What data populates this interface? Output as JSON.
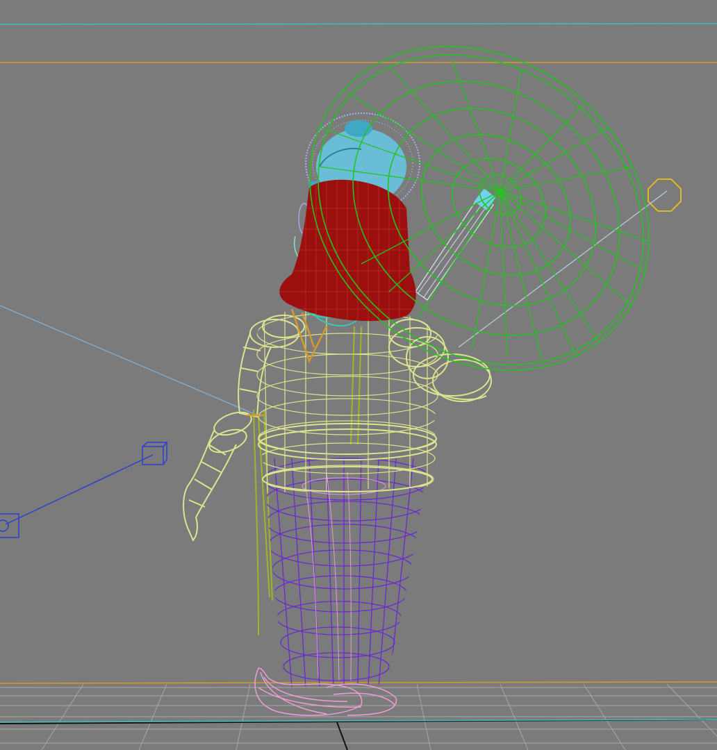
{
  "viewport": {
    "background_color": "#7b7b7b",
    "view": "perspective-wireframe"
  },
  "guides": {
    "safe_frame_color": "#3fbfbf",
    "render_region_color": "#d49a2a"
  },
  "scene_objects": [
    {
      "name": "umbrella",
      "wire_color": "#22c41e"
    },
    {
      "name": "umbrella-handle",
      "wire_color": "#6fd1ee"
    },
    {
      "name": "hair",
      "wire_color": "#9b0f0f"
    },
    {
      "name": "head",
      "wire_color": "#67c9e6"
    },
    {
      "name": "hair-bun",
      "wire_color": "#a5b2ff"
    },
    {
      "name": "shirt",
      "wire_color": "#dde48f"
    },
    {
      "name": "trousers",
      "wire_color": "#6a2ad0"
    },
    {
      "name": "trouser-details",
      "wire_color": "#e39bdc"
    },
    {
      "name": "shoes",
      "wire_color": "#ef9dd9"
    },
    {
      "name": "sash",
      "wire_color": "#9fb52a"
    },
    {
      "name": "belt",
      "wire_color": "#d49a2a"
    }
  ],
  "helpers": {
    "target_helper_color": "#e8c21b",
    "camera_helper_color": "#2a3fd1",
    "light_line_color": "#7fb1d6"
  },
  "grid": {
    "color": "#a8a8a8",
    "visible": true
  }
}
